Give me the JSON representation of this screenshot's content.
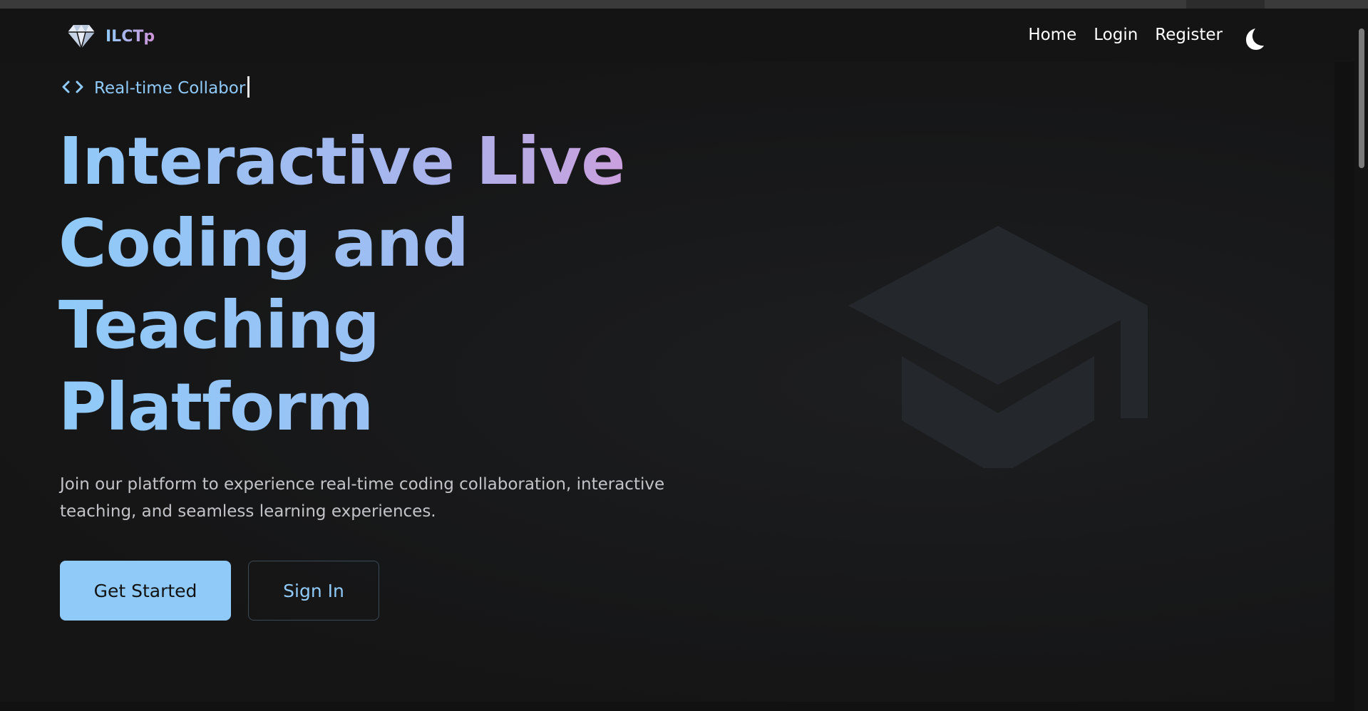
{
  "brand": {
    "name": "ILCTp",
    "logo_icon": "diamond-icon"
  },
  "nav": {
    "links": [
      "Home",
      "Login",
      "Register"
    ],
    "theme_toggle_icon": "moon-icon"
  },
  "hero": {
    "tag_icon": "code-icon",
    "tag_text": "Real-time Collabor",
    "headline_lines": [
      "Interactive Live",
      "Coding and",
      "Teaching",
      "Platform"
    ],
    "subtitle": "Join our platform to experience real-time coding collaboration, interactive teaching, and seamless learning experiences.",
    "primary_button": "Get Started",
    "secondary_button": "Sign In",
    "illustration_icon": "graduation-cap-icon"
  },
  "colors": {
    "background": "#111112",
    "accent_blue": "#90caf9",
    "accent_purple": "#ce93d8",
    "illustration": "#24282d"
  }
}
